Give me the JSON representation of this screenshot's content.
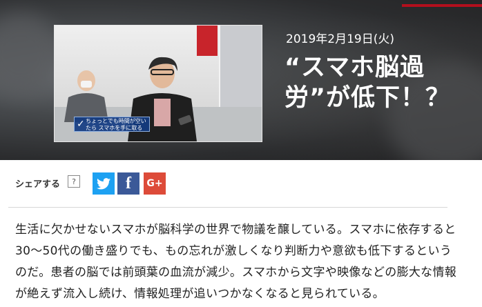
{
  "article": {
    "date": "2019年2月19日(火)",
    "title": "“スマホ脳過労”が低下！？",
    "thumbnail_caption": "ちょっとでも時間が空いたら スマホを手に取る",
    "body": "生活に欠かせないスマホが脳科学の世界で物議を醸している。スマホに依存すると30～50代の働き盛りでも、もの忘れが激しくなり判断力や意欲も低下するというのだ。患者の脳では前頭葉の血流が減少。スマホから文字や映像などの膨大な情報が絶えず流入し続け、情報処理が追いつかなくなると見られている。"
  },
  "share": {
    "label": "シェアする",
    "help": "?",
    "buttons": [
      {
        "name": "twitter",
        "icon": "twitter-bird-icon",
        "color": "#1da1f2"
      },
      {
        "name": "facebook",
        "icon": "facebook-f-icon",
        "glyph": "f",
        "color": "#3b5998"
      },
      {
        "name": "google-plus",
        "icon": "google-plus-icon",
        "glyph": "G+",
        "color": "#dd4b39"
      }
    ]
  },
  "colors": {
    "accent_red": "#b30f1d"
  }
}
